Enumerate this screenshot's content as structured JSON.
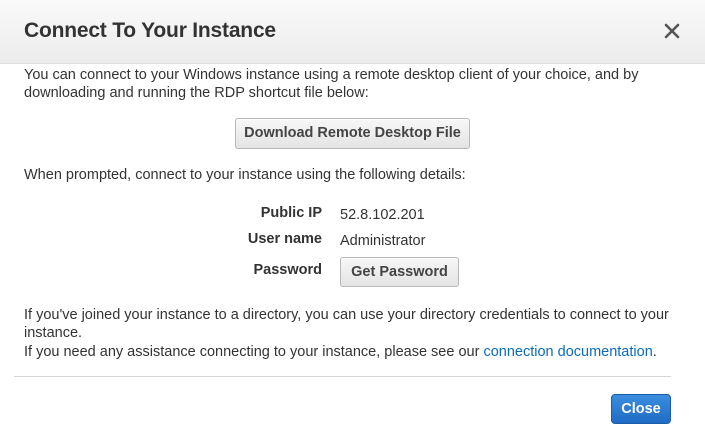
{
  "dialog": {
    "title": "Connect To Your Instance",
    "close_icon": "close-icon"
  },
  "intro": {
    "line1": "You can connect to your Windows instance using a remote desktop client of your choice, and by",
    "line2": "downloading and running the RDP shortcut file below:"
  },
  "download_button_label": "Download Remote Desktop File",
  "prompt_text": "When prompted, connect to your instance using the following details:",
  "details": {
    "public_ip_label": "Public IP",
    "public_ip_value": "52.8.102.201",
    "user_name_label": "User name",
    "user_name_value": "Administrator",
    "password_label": "Password",
    "get_password_label": "Get Password"
  },
  "directory_note": {
    "line1": "If you've joined your instance to a directory, you can use your directory credentials to connect to your",
    "line2": "instance."
  },
  "assistance": {
    "text": "If you need any assistance connecting to your instance, please see our",
    "link_text": "connection documentation",
    "suffix": "."
  },
  "footer": {
    "close_label": "Close"
  },
  "colors": {
    "link": "#0b6bbf",
    "primary": "#1f6cc4"
  }
}
